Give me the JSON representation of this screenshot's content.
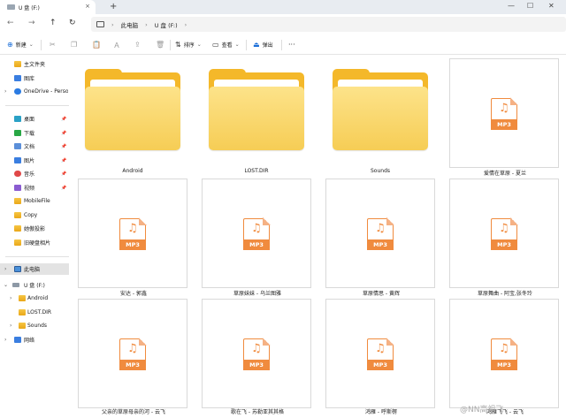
{
  "window": {
    "tab_title": "U 盘 (F:)",
    "tab_close": "×",
    "new_tab": "+",
    "controls": [
      "—",
      "☐",
      "✕"
    ]
  },
  "nav": {
    "back": "←",
    "forward": "→",
    "up": "↑",
    "refresh": "↻",
    "breadcrumb": [
      "此电脑",
      "U 盘 (F:)"
    ],
    "separator": "›"
  },
  "commands": {
    "new": "新建",
    "sort": "排序",
    "view": "查看",
    "eject": "弹出",
    "more": "···"
  },
  "sidebar": {
    "quick": [
      {
        "label": "主文件夹",
        "icon": "home-icon"
      },
      {
        "label": "图库",
        "icon": "gallery-icon"
      },
      {
        "label": "OneDrive - Perso",
        "icon": "cloud-icon"
      }
    ],
    "pinned": [
      {
        "label": "桌面",
        "icon": "desktop-icon"
      },
      {
        "label": "下载",
        "icon": "download-icon"
      },
      {
        "label": "文档",
        "icon": "document-icon"
      },
      {
        "label": "图片",
        "icon": "pictures-icon"
      },
      {
        "label": "音乐",
        "icon": "music-icon"
      },
      {
        "label": "视频",
        "icon": "video-icon"
      },
      {
        "label": "MobileFile",
        "icon": "folder-icon"
      },
      {
        "label": "Copy",
        "icon": "folder-icon"
      },
      {
        "label": "她傲投影",
        "icon": "folder-icon"
      },
      {
        "label": "旧硬盘相片",
        "icon": "folder-icon"
      }
    ],
    "tree": [
      {
        "label": "此电脑",
        "icon": "pc-icon"
      },
      {
        "label": "U 盘 (F:)",
        "icon": "drive-icon"
      },
      {
        "label": "Android",
        "icon": "folder-icon"
      },
      {
        "label": "LOST.DIR",
        "icon": "folder-icon"
      },
      {
        "label": "Sounds",
        "icon": "folder-icon"
      },
      {
        "label": "网络",
        "icon": "network-icon"
      }
    ]
  },
  "files": [
    {
      "name": "Android",
      "type": "folder"
    },
    {
      "name": "LOST.DIR",
      "type": "folder"
    },
    {
      "name": "Sounds",
      "type": "folder"
    },
    {
      "name": "爱情在草原 - 夏兰",
      "type": "mp3"
    },
    {
      "name": "安达 - 郭鑫",
      "type": "mp3"
    },
    {
      "name": "草原妹妹 - 乌兰图雅",
      "type": "mp3"
    },
    {
      "name": "草原情思 - 黄辉",
      "type": "mp3"
    },
    {
      "name": "草原舞曲 - 阿宝,张冬玲",
      "type": "mp3"
    },
    {
      "name": "父亲的草原母亲的河 - 云飞",
      "type": "mp3"
    },
    {
      "name": "歌在飞 - 苏勒亚其其格",
      "type": "mp3"
    },
    {
      "name": "鸿雁 - 呼斯楞",
      "type": "mp3"
    },
    {
      "name": "鸿雁飞飞 - 云飞",
      "type": "mp3"
    }
  ],
  "mp3_badge": "MP3",
  "watermark": "@NN高祖飞"
}
